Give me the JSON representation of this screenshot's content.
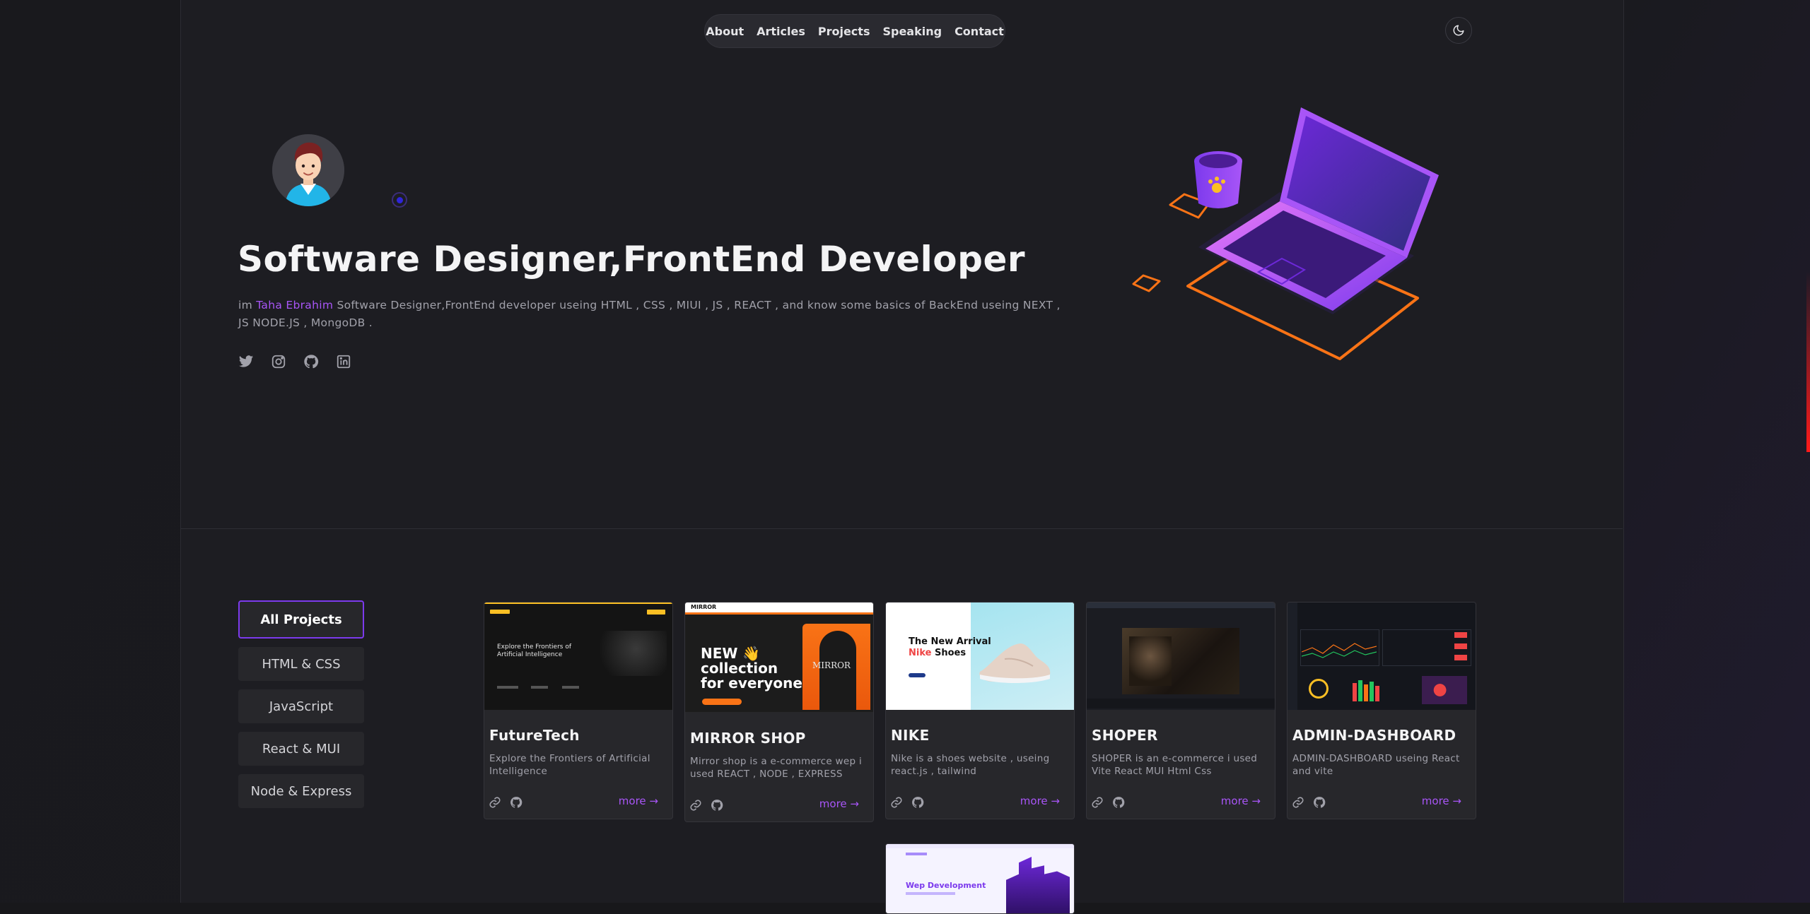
{
  "nav": {
    "items": [
      "About",
      "Articles",
      "Projects",
      "Speaking",
      "Contact"
    ],
    "theme_icon": "moon-icon"
  },
  "hero": {
    "title": "Software Designer,FrontEnd Developer",
    "desc_prefix": "im ",
    "desc_name": "Taha Ebrahim",
    "desc_rest": " Software Designer,FrontEnd developer useing HTML , CSS , MIUI , JS , REACT , and know some basics of BackEnd useing NEXT , JS NODE.JS , MongoDB .",
    "socials": [
      "twitter-icon",
      "instagram-icon",
      "github-icon",
      "linkedin-icon"
    ]
  },
  "filters": [
    "All Projects",
    "HTML & CSS",
    "JavaScript",
    "React & MUI",
    "Node & Express"
  ],
  "projects": [
    {
      "title": "FutureTech",
      "desc": "Explore the Frontiers of Artificial Intelligence",
      "more": "more",
      "thumb": {
        "heading_1": "Explore the Frontiers of",
        "heading_2": "Artificial Intelligence"
      }
    },
    {
      "title": "MIRROR SHOP",
      "desc": "Mirror shop is a e-commerce wep i used REACT , NODE , EXPRESS",
      "more": "more",
      "thumb": {
        "brand": "MIRROR",
        "line_1": "NEW 👋",
        "line_2": "collection",
        "line_3": "for everyone",
        "side": "MIRROR"
      }
    },
    {
      "title": "NIKE",
      "desc": "Nike is a shoes website , useing react.js , tailwind",
      "more": "more",
      "thumb": {
        "heading_1": "The New Arrival",
        "heading_2a": "Nike",
        "heading_2b": " Shoes"
      }
    },
    {
      "title": "SHOPER",
      "desc": "SHOPER is an e-commerce i used Vite React MUI Html Css",
      "more": "more"
    },
    {
      "title": "ADMIN-DASHBOARD",
      "desc": "ADMIN-DASHBOARD useing React and vite",
      "more": "more"
    }
  ],
  "partial_project": {
    "thumb_title": "Wep Development"
  },
  "colors": {
    "accent": "#a855f7",
    "active_border": "#7c3aed",
    "bg": "#1d1d22",
    "card": "#27272b"
  }
}
